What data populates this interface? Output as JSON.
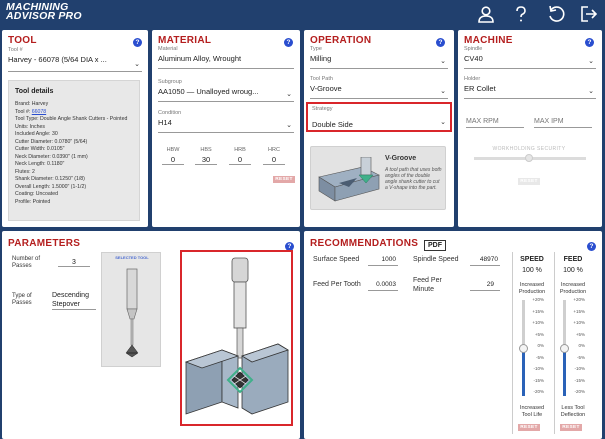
{
  "app": {
    "logo_line1": "MACHINING",
    "logo_line2": "ADVISOR PRO",
    "top_icons": [
      "user-icon",
      "help-icon",
      "refresh-icon",
      "logout-icon"
    ]
  },
  "tool": {
    "title": "TOOL",
    "field_label": "Tool #",
    "field_value": "Harvey - 66078 (5/64 DIA x ...",
    "details_title": "Tool details",
    "details": [
      {
        "label": "Brand",
        "value": "Harvey"
      },
      {
        "label": "Tool #",
        "value": "66078",
        "link": true
      },
      {
        "label": "Tool Type",
        "value": "Double Angle Shank Cutters - Pointed"
      },
      {
        "label": "Units",
        "value": "Inches"
      },
      {
        "label": "Included Angle",
        "value": "30"
      },
      {
        "label": "Cutter Diameter",
        "value": "0.0780\" (5/64)"
      },
      {
        "label": "Cutter Width",
        "value": "0.0105\""
      },
      {
        "label": "Neck Diameter",
        "value": "0.0390\" (1 mm)"
      },
      {
        "label": "Neck Length",
        "value": "0.1180\""
      },
      {
        "label": "Flutes",
        "value": "2"
      },
      {
        "label": "Shank Diameter",
        "value": "0.1250\" (1/8)"
      },
      {
        "label": "Overall Length",
        "value": "1.5000\" (1-1/2)"
      },
      {
        "label": "Coating",
        "value": "Uncoated"
      },
      {
        "label": "Profile",
        "value": "Pointed"
      }
    ]
  },
  "material": {
    "title": "MATERIAL",
    "material_label": "Material",
    "material_value": "Aluminum Alloy, Wrought",
    "subgroup_label": "Subgroup",
    "subgroup_value": "AA1050 — Unalloyed wroug...",
    "condition_label": "Condition",
    "condition_value": "H14",
    "hardness": [
      {
        "label": "HBW",
        "value": "0"
      },
      {
        "label": "HBS",
        "value": "30"
      },
      {
        "label": "HRB",
        "value": "0"
      },
      {
        "label": "HRC",
        "value": "0"
      }
    ],
    "reset_label": "RESET"
  },
  "operation": {
    "title": "OPERATION",
    "type_label": "Type",
    "type_value": "Milling",
    "toolpath_label": "Tool Path",
    "toolpath_value": "V-Groove",
    "strategy_label": "Strategy",
    "strategy_value": "Double Side",
    "card_title": "V-Groove",
    "card_desc": "A tool path that uses both angles of the double angle shank cutter to cut a V-shape into the part."
  },
  "machine": {
    "title": "MACHINE",
    "spindle_label": "Spindle",
    "spindle_value": "CV40",
    "holder_label": "Holder",
    "holder_value": "ER Collet",
    "max_rpm_placeholder": "MAX RPM",
    "max_ipm_placeholder": "MAX IPM",
    "security_label": "WORKHOLDING SECURITY",
    "reset_label": "RESET"
  },
  "parameters": {
    "title": "PARAMETERS",
    "passes_label_1": "Number of",
    "passes_label_2": "Passes",
    "passes_value": "3",
    "type_label_1": "Type of",
    "type_label_2": "Passes",
    "type_value_1": "Descending",
    "type_value_2": "Stepover",
    "selected_tool_label": "SELECTED TOOL"
  },
  "recommendations": {
    "title": "RECOMMENDATIONS",
    "pdf_label": "PDF",
    "surface_speed_label": "Surface Speed",
    "surface_speed_value": "1000",
    "spindle_speed_label": "Spindle Speed",
    "spindle_speed_value": "48970",
    "feed_tooth_label": "Feed Per Tooth",
    "feed_tooth_value": "0.0003",
    "feed_minute_label_1": "Feed Per",
    "feed_minute_label_2": "Minute",
    "feed_minute_value": "29",
    "speed": {
      "title": "SPEED",
      "percent": "100 %",
      "top_1": "Increased",
      "top_2": "Production",
      "bottom_1": "Increased",
      "bottom_2": "Tool Life",
      "reset": "RESET",
      "level_percent": 0
    },
    "feed": {
      "title": "FEED",
      "percent": "100 %",
      "top_1": "Increased",
      "top_2": "Production",
      "bottom_1": "Less Tool",
      "bottom_2": "Deflection",
      "reset": "RESET",
      "level_percent": 0
    },
    "ticks": [
      "+20%",
      "+15%",
      "+10%",
      "+5%",
      "0%",
      "-5%",
      "-10%",
      "-15%",
      "-20%"
    ]
  }
}
